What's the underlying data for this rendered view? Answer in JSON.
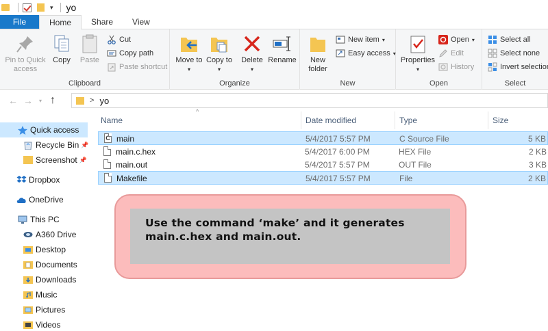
{
  "window": {
    "title": "yo"
  },
  "tabs": [
    {
      "label": "File"
    },
    {
      "label": "Home"
    },
    {
      "label": "Share"
    },
    {
      "label": "View"
    }
  ],
  "ribbon": {
    "clipboard": {
      "label": "Clipboard",
      "pin_label": "Pin to Quick access",
      "copy_label": "Copy",
      "paste_label": "Paste",
      "cut_label": "Cut",
      "copy_path_label": "Copy path",
      "paste_shortcut_label": "Paste shortcut"
    },
    "organize": {
      "label": "Organize",
      "move_to_label": "Move to",
      "copy_to_label": "Copy to",
      "delete_label": "Delete",
      "rename_label": "Rename"
    },
    "new": {
      "label": "New",
      "new_folder_label": "New folder",
      "new_item_label": "New item",
      "easy_access_label": "Easy access"
    },
    "open": {
      "label": "Open",
      "properties_label": "Properties",
      "open_label": "Open",
      "edit_label": "Edit",
      "history_label": "History"
    },
    "select": {
      "label": "Select",
      "select_all_label": "Select all",
      "select_none_label": "Select none",
      "invert_selection_label": "Invert selection"
    }
  },
  "address": {
    "path": "yo"
  },
  "navpane": {
    "items": [
      {
        "label": "Quick access"
      },
      {
        "label": "Recycle Bin"
      },
      {
        "label": "Screenshot"
      },
      {
        "label": "Dropbox"
      },
      {
        "label": "OneDrive"
      },
      {
        "label": "This PC"
      },
      {
        "label": "A360 Drive"
      },
      {
        "label": "Desktop"
      },
      {
        "label": "Documents"
      },
      {
        "label": "Downloads"
      },
      {
        "label": "Music"
      },
      {
        "label": "Pictures"
      },
      {
        "label": "Videos"
      }
    ]
  },
  "filelist": {
    "columns": {
      "name": "Name",
      "date": "Date modified",
      "type": "Type",
      "size": "Size"
    },
    "rows": [
      {
        "name": "main",
        "date": "5/4/2017 5:57 PM",
        "type": "C Source File",
        "size": "5 KB",
        "icon": "c-file-icon",
        "glyph": "C"
      },
      {
        "name": "main.c.hex",
        "date": "5/4/2017 6:00 PM",
        "type": "HEX File",
        "size": "2 KB",
        "icon": "file-icon",
        "glyph": ""
      },
      {
        "name": "main.out",
        "date": "5/4/2017 5:57 PM",
        "type": "OUT File",
        "size": "3 KB",
        "icon": "file-icon",
        "glyph": ""
      },
      {
        "name": "Makefile",
        "date": "5/4/2017 5:57 PM",
        "type": "File",
        "size": "2 KB",
        "icon": "file-icon",
        "glyph": ""
      }
    ]
  },
  "annotation": {
    "text": "Use the command ‘make’ and it generates main.c.hex and main.out."
  },
  "colors": {
    "file_tab": "#1979ca",
    "selection": "#cce8ff",
    "callout_outer": "#fcbcbc",
    "callout_inner": "#c4c4c4",
    "folder": "#f4c552"
  }
}
